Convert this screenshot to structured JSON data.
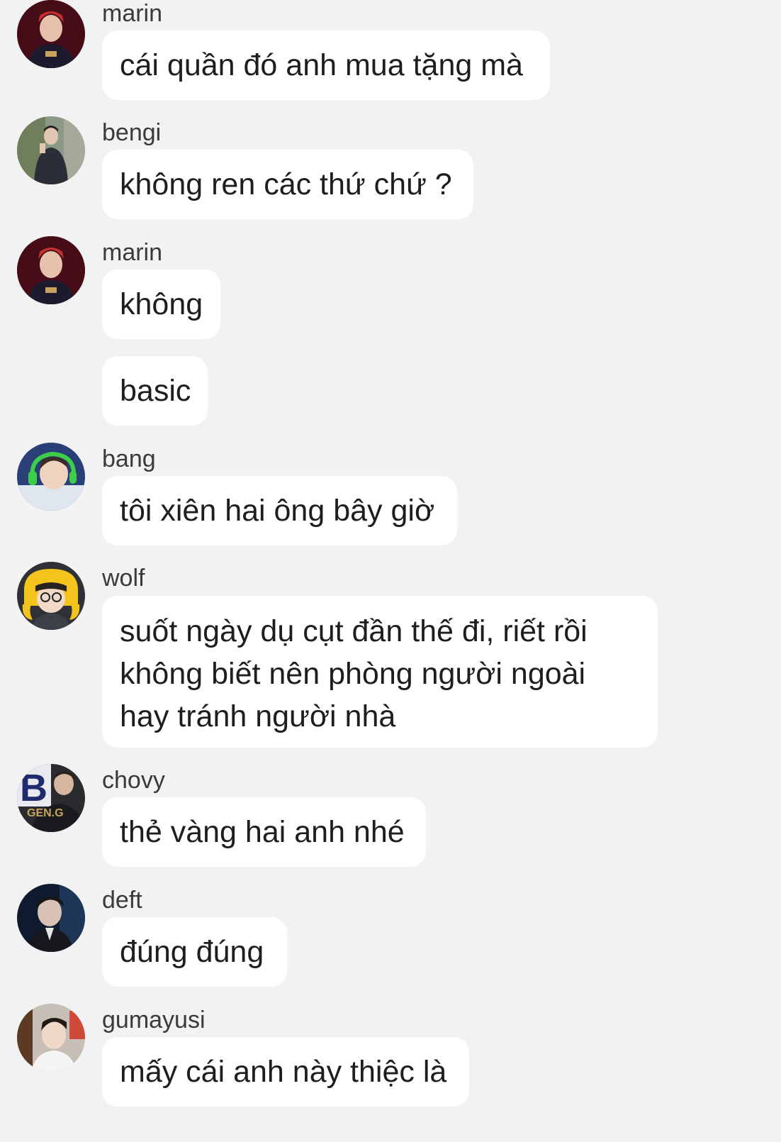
{
  "messages": [
    {
      "sender": "marin",
      "avatar_icon": "avatar-marin-icon",
      "text": "cái quần đó anh mua tặng mà"
    },
    {
      "sender": "bengi",
      "avatar_icon": "avatar-bengi-icon",
      "text": "không ren các thứ chứ ?"
    },
    {
      "sender": "marin",
      "avatar_icon": "avatar-marin-icon",
      "text": "không"
    },
    {
      "sender": "",
      "text": "basic"
    },
    {
      "sender": "bang",
      "avatar_icon": "avatar-bang-icon",
      "text": "tôi xiên hai ông bây giờ"
    },
    {
      "sender": "wolf",
      "avatar_icon": "avatar-wolf-icon",
      "lines": [
        "suốt ngày dụ cụt đần thế đi, riết rồi",
        "không biết nên phòng người ngoài",
        "hay tránh người nhà"
      ]
    },
    {
      "sender": "chovy",
      "avatar_icon": "avatar-chovy-icon",
      "avatar_text": "GEN.G",
      "text": "thẻ vàng hai anh nhé"
    },
    {
      "sender": "deft",
      "avatar_icon": "avatar-deft-icon",
      "text": "đúng đúng"
    },
    {
      "sender": "gumayusi",
      "avatar_icon": "avatar-gumayusi-icon",
      "text": "mấy cái anh này thiệc là"
    }
  ],
  "colors": {
    "background": "#f2f2f2",
    "bubble": "#ffffff",
    "sender_text": "#3a3a3a",
    "message_text": "#1e1e1e"
  }
}
